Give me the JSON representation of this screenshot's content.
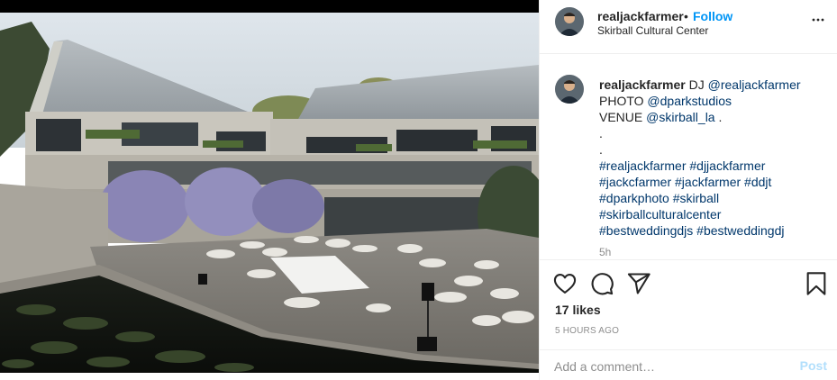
{
  "header": {
    "username": "realjackfarmer",
    "separator": "•",
    "follow_label": "Follow",
    "location": "Skirball Cultural Center",
    "more_icon": "more-horizontal-icon"
  },
  "caption": {
    "username": "realjackfarmer",
    "lines": [
      {
        "prefix": "DJ ",
        "mention": "@realjackfarmer",
        "suffix": ""
      },
      {
        "prefix": "PHOTO ",
        "mention": "@dparkstudios",
        "suffix": ""
      },
      {
        "prefix": "VENUE ",
        "mention": "@skirball_la",
        "suffix": " ."
      }
    ],
    "dots": [
      ".",
      "."
    ],
    "hashtags": [
      "#realjackfarmer #djjackfarmer",
      "#jackcfarmer #jackfarmer #ddjt",
      "#dparkphoto #skirball",
      "#skirballculturalcenter",
      "#bestweddingdjs #bestweddingdj"
    ],
    "time": "5h"
  },
  "actions": {
    "icons": [
      "heart-icon",
      "comment-icon",
      "share-icon",
      "bookmark-icon"
    ]
  },
  "likes_text": "17 likes",
  "posted_text": "5 HOURS AGO",
  "comment_box": {
    "placeholder": "Add a comment…",
    "post_label": "Post"
  },
  "colors": {
    "link_blue": "#0095f6",
    "mention": "#00376b",
    "muted": "#8e8e8e",
    "post_disabled": "#b2dffc",
    "border": "#efefef"
  }
}
